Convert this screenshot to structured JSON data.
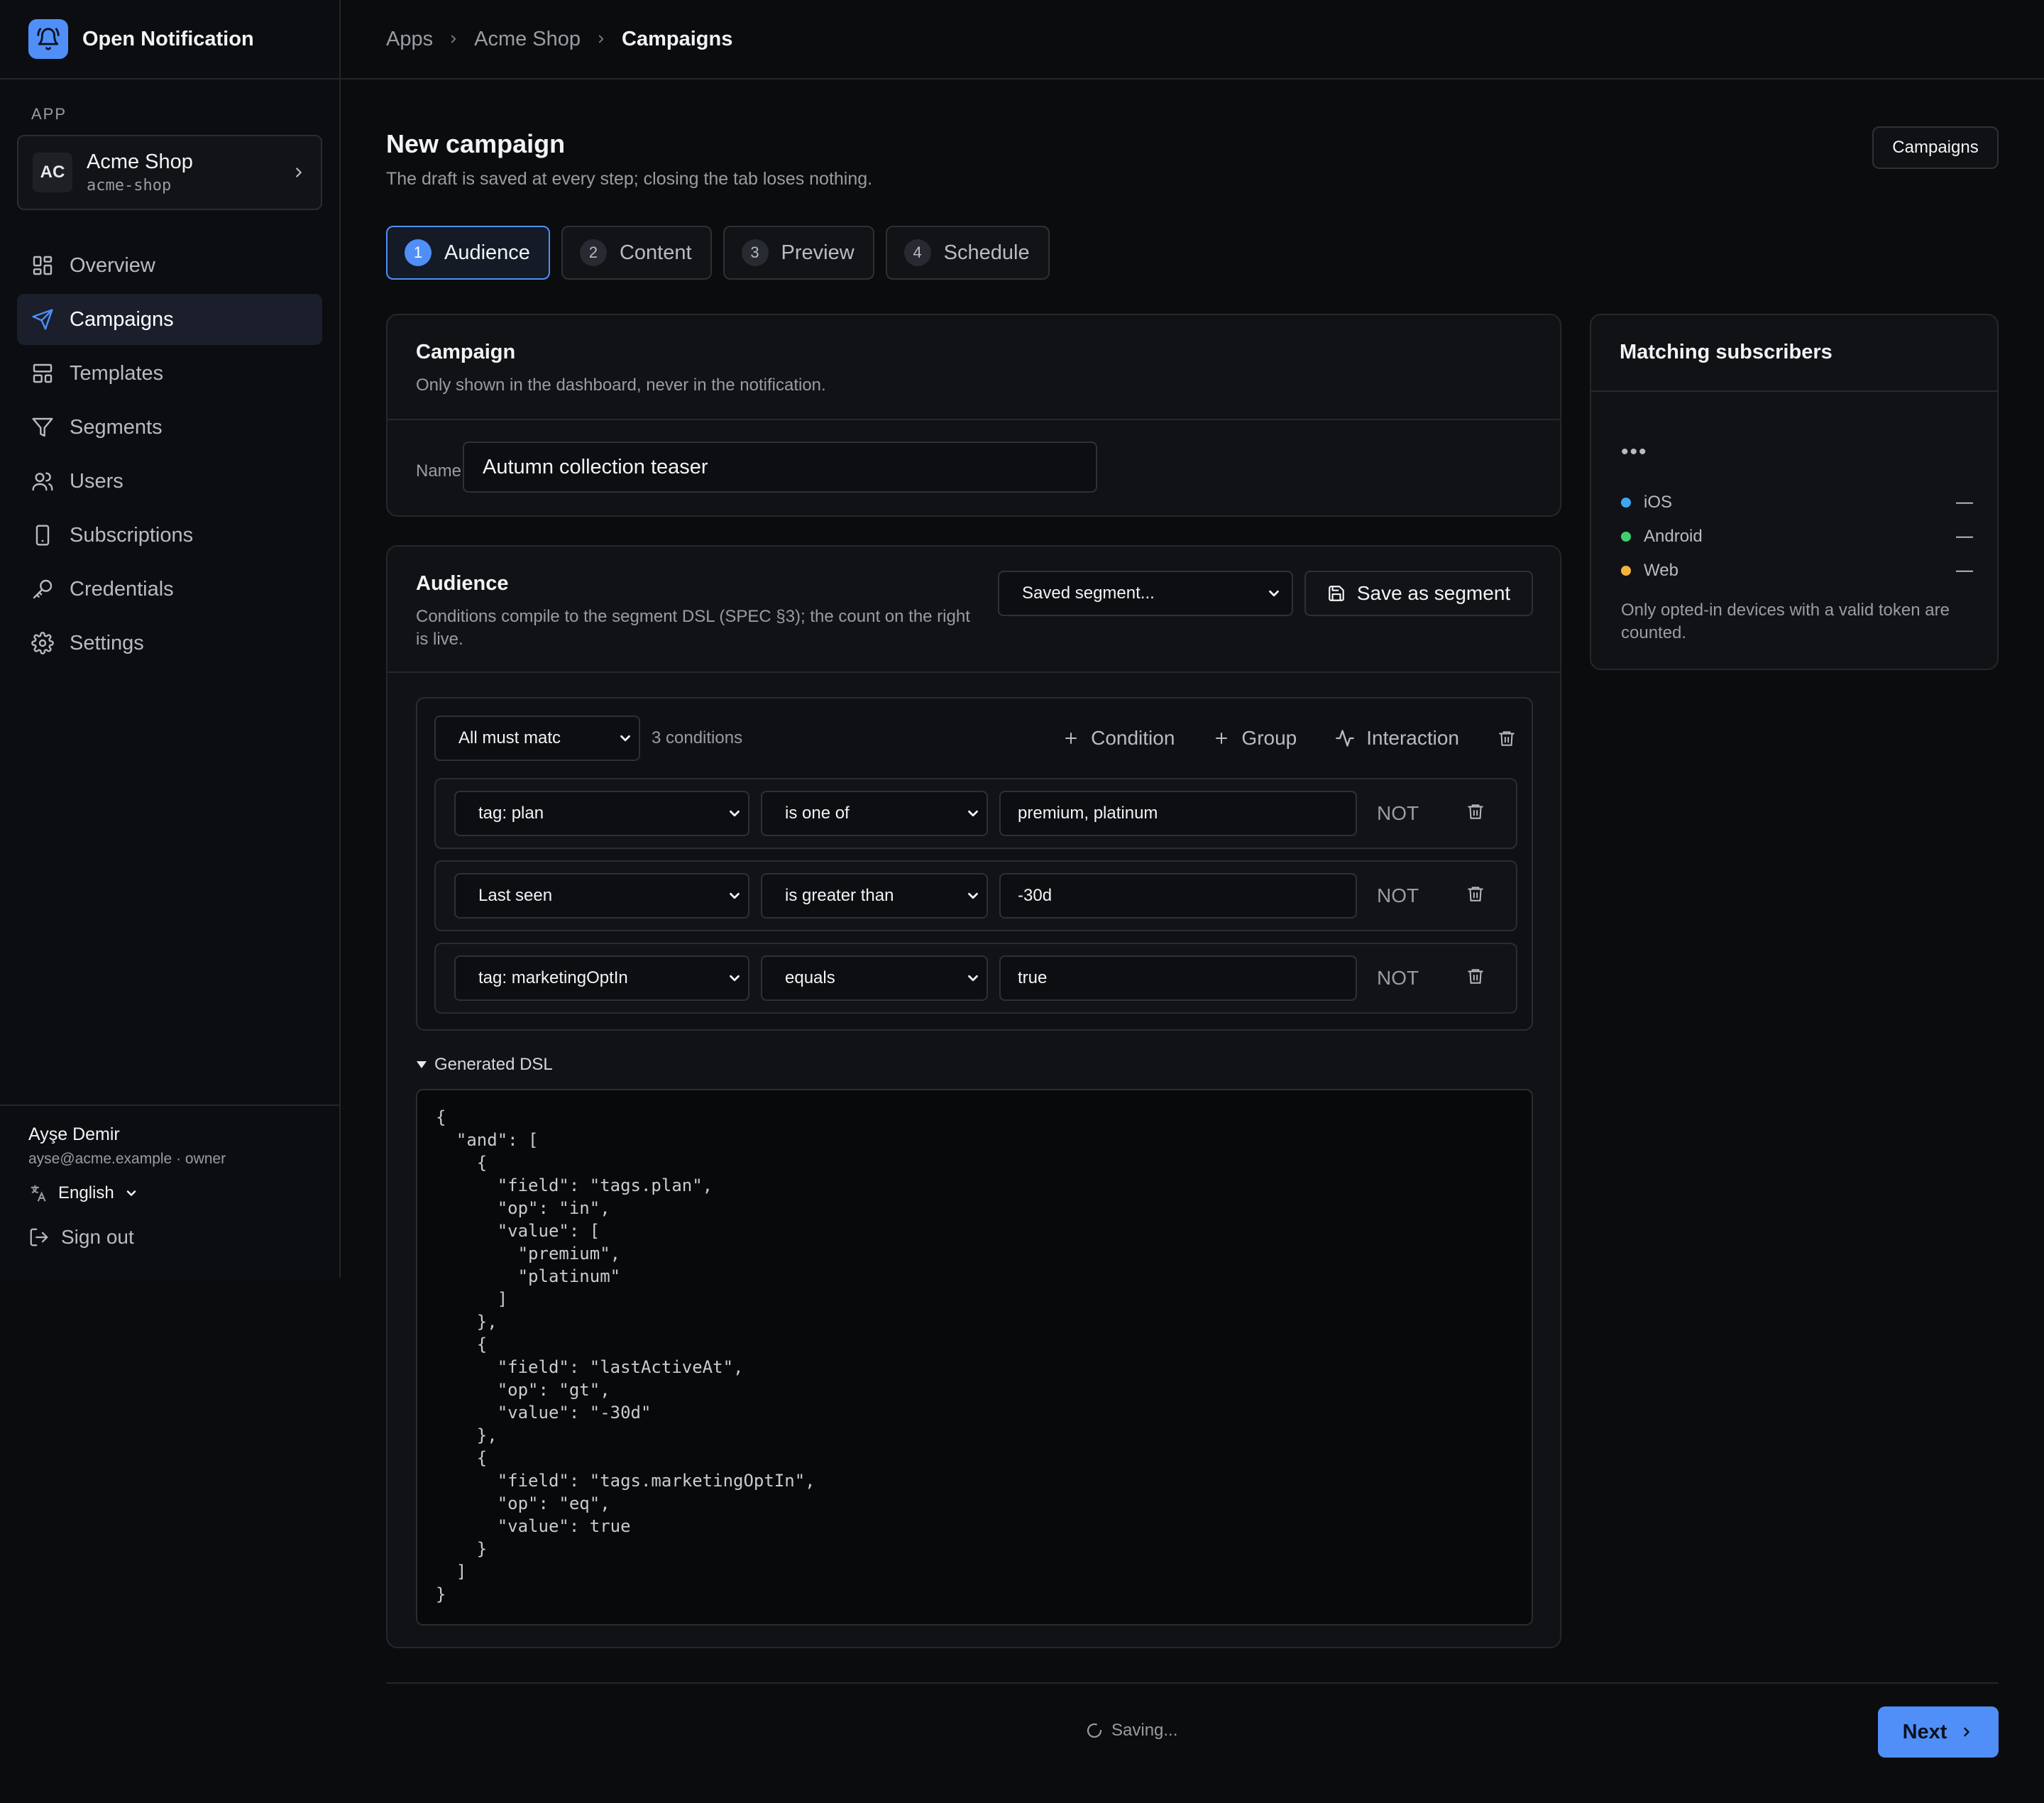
{
  "brand": {
    "name": "Open Notification",
    "icon": "bell-icon"
  },
  "sidebar": {
    "section_label": "APP",
    "app": {
      "initials": "AC",
      "name": "Acme Shop",
      "slug": "acme-shop"
    },
    "items": [
      {
        "label": "Overview",
        "icon": "grid-icon"
      },
      {
        "label": "Campaigns",
        "icon": "send-icon",
        "active": true
      },
      {
        "label": "Templates",
        "icon": "layout-icon"
      },
      {
        "label": "Segments",
        "icon": "filter-icon"
      },
      {
        "label": "Users",
        "icon": "users-icon"
      },
      {
        "label": "Subscriptions",
        "icon": "device-icon"
      },
      {
        "label": "Credentials",
        "icon": "key-icon"
      },
      {
        "label": "Settings",
        "icon": "gear-icon"
      }
    ],
    "user": {
      "name": "Ayşe Demir",
      "meta": "ayse@acme.example · owner"
    },
    "language": "English",
    "sign_out": "Sign out"
  },
  "breadcrumb": [
    "Apps",
    "Acme Shop",
    "Campaigns"
  ],
  "page": {
    "title": "New campaign",
    "subtitle": "The draft is saved at every step; closing the tab loses nothing.",
    "top_button": "Campaigns"
  },
  "steps": [
    {
      "num": "1",
      "label": "Audience",
      "active": true
    },
    {
      "num": "2",
      "label": "Content"
    },
    {
      "num": "3",
      "label": "Preview"
    },
    {
      "num": "4",
      "label": "Schedule"
    }
  ],
  "campaign_card": {
    "title": "Campaign",
    "description": "Only shown in the dashboard, never in the notification.",
    "name_label": "Name",
    "name_value": "Autumn collection teaser"
  },
  "audience_card": {
    "title": "Audience",
    "description": "Conditions compile to the segment DSL (SPEC §3); the count on the right is live.",
    "saved_segment_placeholder": "Saved segment...",
    "save_as_segment": "Save as segment",
    "match_mode": "All must matc",
    "condition_count": "3 conditions",
    "actions": {
      "condition": "Condition",
      "group": "Group",
      "interaction": "Interaction"
    },
    "conditions": [
      {
        "field": "tag: plan",
        "op": "is one of",
        "value": "premium, platinum",
        "not": "NOT"
      },
      {
        "field": "Last seen",
        "op": "is greater than",
        "value": "-30d",
        "not": "NOT"
      },
      {
        "field": "tag: marketingOptIn",
        "op": "equals",
        "value": "true",
        "not": "NOT"
      }
    ],
    "dsl_toggle": "Generated DSL",
    "dsl": "{\n  \"and\": [\n    {\n      \"field\": \"tags.plan\",\n      \"op\": \"in\",\n      \"value\": [\n        \"premium\",\n        \"platinum\"\n      ]\n    },\n    {\n      \"field\": \"lastActiveAt\",\n      \"op\": \"gt\",\n      \"value\": \"-30d\"\n    },\n    {\n      \"field\": \"tags.marketingOptIn\",\n      \"op\": \"eq\",\n      \"value\": true\n    }\n  ]\n}"
  },
  "matching": {
    "title": "Matching subscribers",
    "loading": "•••",
    "platforms": [
      {
        "name": "iOS",
        "value": "—",
        "color": "#3fa7f2"
      },
      {
        "name": "Android",
        "value": "—",
        "color": "#3ecf6e"
      },
      {
        "name": "Web",
        "value": "—",
        "color": "#f2b43a"
      }
    ],
    "note": "Only opted-in devices with a valid token are counted."
  },
  "footer": {
    "status": "Saving...",
    "next": "Next"
  },
  "colors": {
    "accent": "#4f8ff7",
    "background": "#0b0c0e",
    "card": "#111216"
  }
}
